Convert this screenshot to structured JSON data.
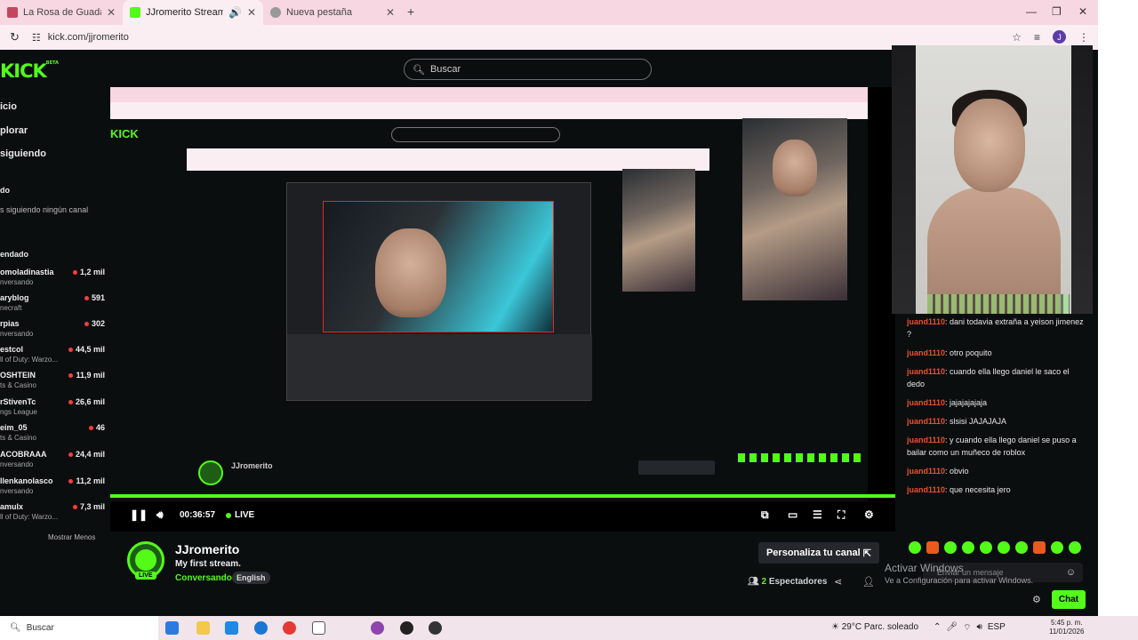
{
  "browser": {
    "tabs": [
      {
        "title": "La Rosa de Guadalupe | La Niñ",
        "active": false
      },
      {
        "title": "JJromerito Stream - Watch",
        "active": true
      },
      {
        "title": "Nueva pestaña",
        "active": false
      }
    ],
    "url": "kick.com/jjromerito",
    "profile_initial": "J"
  },
  "kick": {
    "logo": "KICK",
    "logo_sup": "BETA",
    "search_placeholder": "Buscar",
    "nav": [
      "icio",
      "plorar",
      "siguiendo"
    ],
    "following_header": "do",
    "following_empty": "s siguiendo ningún canal",
    "recommended_header": "endado",
    "channels": [
      {
        "name": "omoladinastia",
        "game": "nversando",
        "viewers": "1,2 mil"
      },
      {
        "name": "aryblog",
        "game": "necraft",
        "viewers": "591"
      },
      {
        "name": "rpias",
        "game": "nversando",
        "viewers": "302"
      },
      {
        "name": "estcol",
        "game": "ll of Duty: Warzo...",
        "viewers": "44,5 mil"
      },
      {
        "name": "OSHTEIN",
        "game": "ts & Casino",
        "viewers": "11,9 mil"
      },
      {
        "name": "rStivenTc",
        "game": "ngs League",
        "viewers": "26,6 mil"
      },
      {
        "name": "eim_05",
        "game": "ts & Casino",
        "viewers": "46"
      },
      {
        "name": "ACOBRAAA",
        "game": "nversando",
        "viewers": "24,4 mil"
      },
      {
        "name": "llenkanolasco",
        "game": "nversando",
        "viewers": "11,2 mil"
      },
      {
        "name": "amulx",
        "game": "ll of Duty: Warzo...",
        "viewers": "7,3 mil"
      }
    ],
    "show_less": "Mostrar Menos"
  },
  "player": {
    "time": "00:36:57",
    "live_label": "LIVE",
    "progress_fraction": 1.0
  },
  "stream": {
    "streamer": "JJromerito",
    "title": "My first stream.",
    "category": "Conversando",
    "language_tag": "English",
    "customize_label": "Personaliza tu canal",
    "viewers_count": "2",
    "viewers_label": "Espectadores"
  },
  "chat": {
    "messages": [
      {
        "user": "juand1110",
        "text": ": dani todavia extraña a yeison jimenez ?"
      },
      {
        "user": "juand1110",
        "text": ": otro poquito"
      },
      {
        "user": "juand1110",
        "text": ": cuando ella llego daniel le saco el dedo"
      },
      {
        "user": "juand1110",
        "text": ": jajajajajaja"
      },
      {
        "user": "juand1110",
        "text": ": slsisi JAJAJAJA"
      },
      {
        "user": "juand1110",
        "text": ": y cuando ella llego daniel se puso a bailar como un muñeco de roblox"
      },
      {
        "user": "juand1110",
        "text": ": obvio"
      },
      {
        "user": "juand1110",
        "text": ": que necesita jero"
      }
    ],
    "input_placeholder": "Enviar un mensaje",
    "send_label": "Chat",
    "activate_title": "Activar Windows",
    "activate_sub": "Ve a Configuración para activar Windows."
  },
  "taskbar": {
    "search": "Buscar",
    "weather": "29°C  Parc. soleado",
    "lang": "ESP",
    "time": "5:45 p. m.",
    "date": "11/01/2026"
  },
  "colors": {
    "kick_green": "#53fc18",
    "chat_username": "#f04f2c",
    "tab_bar": "#f7d7e2"
  }
}
